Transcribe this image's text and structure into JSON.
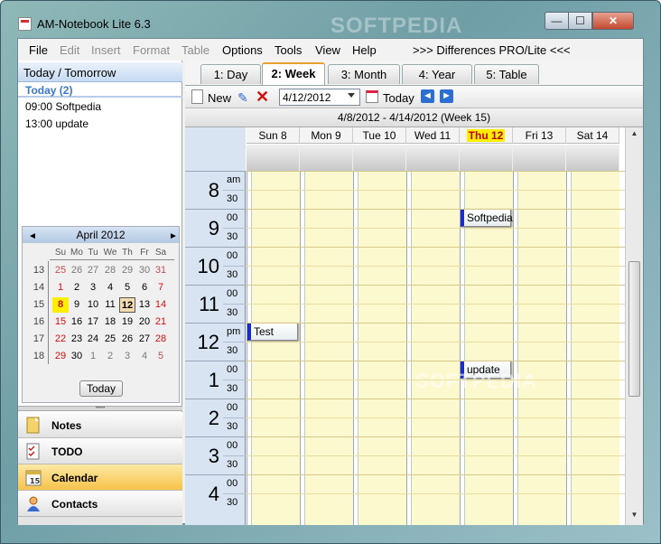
{
  "window": {
    "title": "AM-Notebook Lite  6.3",
    "watermark": "SOFTPEDIA",
    "minimize_glyph": "—",
    "maximize_glyph": "☐",
    "close_glyph": "✕"
  },
  "menu": {
    "items": [
      {
        "label": "File",
        "enabled": true
      },
      {
        "label": "Edit",
        "enabled": false
      },
      {
        "label": "Insert",
        "enabled": false
      },
      {
        "label": "Format",
        "enabled": false
      },
      {
        "label": "Table",
        "enabled": false
      },
      {
        "label": "Options",
        "enabled": true
      },
      {
        "label": "Tools",
        "enabled": true
      },
      {
        "label": "View",
        "enabled": true
      },
      {
        "label": "Help",
        "enabled": true
      },
      {
        "label": ">>> Differences PRO/Lite <<<",
        "enabled": true
      }
    ]
  },
  "sidebar": {
    "header": "Today / Tomorrow",
    "today_label": "Today (2)",
    "events": [
      "09:00 Softpedia",
      "13:00 update"
    ],
    "calendar": {
      "month": "April 2012",
      "prev_glyph": "◄",
      "next_glyph": "►",
      "weekdays": [
        "Su",
        "Mo",
        "Tu",
        "We",
        "Th",
        "Fr",
        "Sa"
      ],
      "weeks": [
        {
          "no": "13",
          "days": [
            "25",
            "26",
            "27",
            "28",
            "29",
            "30",
            "31"
          ]
        },
        {
          "no": "14",
          "days": [
            "1",
            "2",
            "3",
            "4",
            "5",
            "6",
            "7"
          ]
        },
        {
          "no": "15",
          "days": [
            "8",
            "9",
            "10",
            "11",
            "12",
            "13",
            "14"
          ]
        },
        {
          "no": "16",
          "days": [
            "15",
            "16",
            "17",
            "18",
            "19",
            "20",
            "21"
          ]
        },
        {
          "no": "17",
          "days": [
            "22",
            "23",
            "24",
            "25",
            "26",
            "27",
            "28"
          ]
        },
        {
          "no": "18",
          "days": [
            "29",
            "30",
            "1",
            "2",
            "3",
            "4",
            "5"
          ]
        }
      ],
      "today_button": "Today"
    },
    "nav": [
      {
        "label": "Notes",
        "icon": "note-icon"
      },
      {
        "label": "TODO",
        "icon": "checklist-icon"
      },
      {
        "label": "Calendar",
        "icon": "calendar-icon",
        "selected": true
      },
      {
        "label": "Contacts",
        "icon": "contact-icon"
      }
    ],
    "nav_grip": "•••••"
  },
  "tabs": [
    "1: Day",
    "2: Week",
    "3: Month",
    "4: Year",
    "5: Table"
  ],
  "toolbar": {
    "new_label": "New",
    "edit_glyph": "✎",
    "delete_glyph": "✕",
    "date_value": "4/12/2012",
    "today_label": "Today",
    "prev_glyph": "◄",
    "next_glyph": "►"
  },
  "week": {
    "range": "4/8/2012  -  4/14/2012   (Week 15)",
    "days": [
      "Sun 8",
      "Mon 9",
      "Tue 10",
      "Wed 11",
      "Thu 12",
      "Fri 13",
      "Sat 14"
    ],
    "today_index": 4,
    "hours": [
      {
        "num": "8",
        "sub": "am"
      },
      {
        "num": "9",
        "sub": "00"
      },
      {
        "num": "10",
        "sub": "00"
      },
      {
        "num": "11",
        "sub": "00"
      },
      {
        "num": "12",
        "sub": "pm"
      },
      {
        "num": "1",
        "sub": "00"
      },
      {
        "num": "2",
        "sub": "00"
      },
      {
        "num": "3",
        "sub": "00"
      },
      {
        "num": "4",
        "sub": "00"
      }
    ],
    "half_label": "30",
    "appointments": [
      {
        "title": "Softpedia",
        "day": 4,
        "hour": 9
      },
      {
        "title": "Test",
        "day": 0,
        "hour": 12
      },
      {
        "title": "update",
        "day": 4,
        "hour": 13
      }
    ]
  },
  "scrollbar": {
    "up_glyph": "▲",
    "down_glyph": "▼"
  },
  "colors": {
    "accent": "#2c6fd0",
    "today_highlight": "#ffee00",
    "sunday_red": "#d01010",
    "appt_border": "#1a2cc8",
    "cell_bg": "#fdf9cf"
  }
}
